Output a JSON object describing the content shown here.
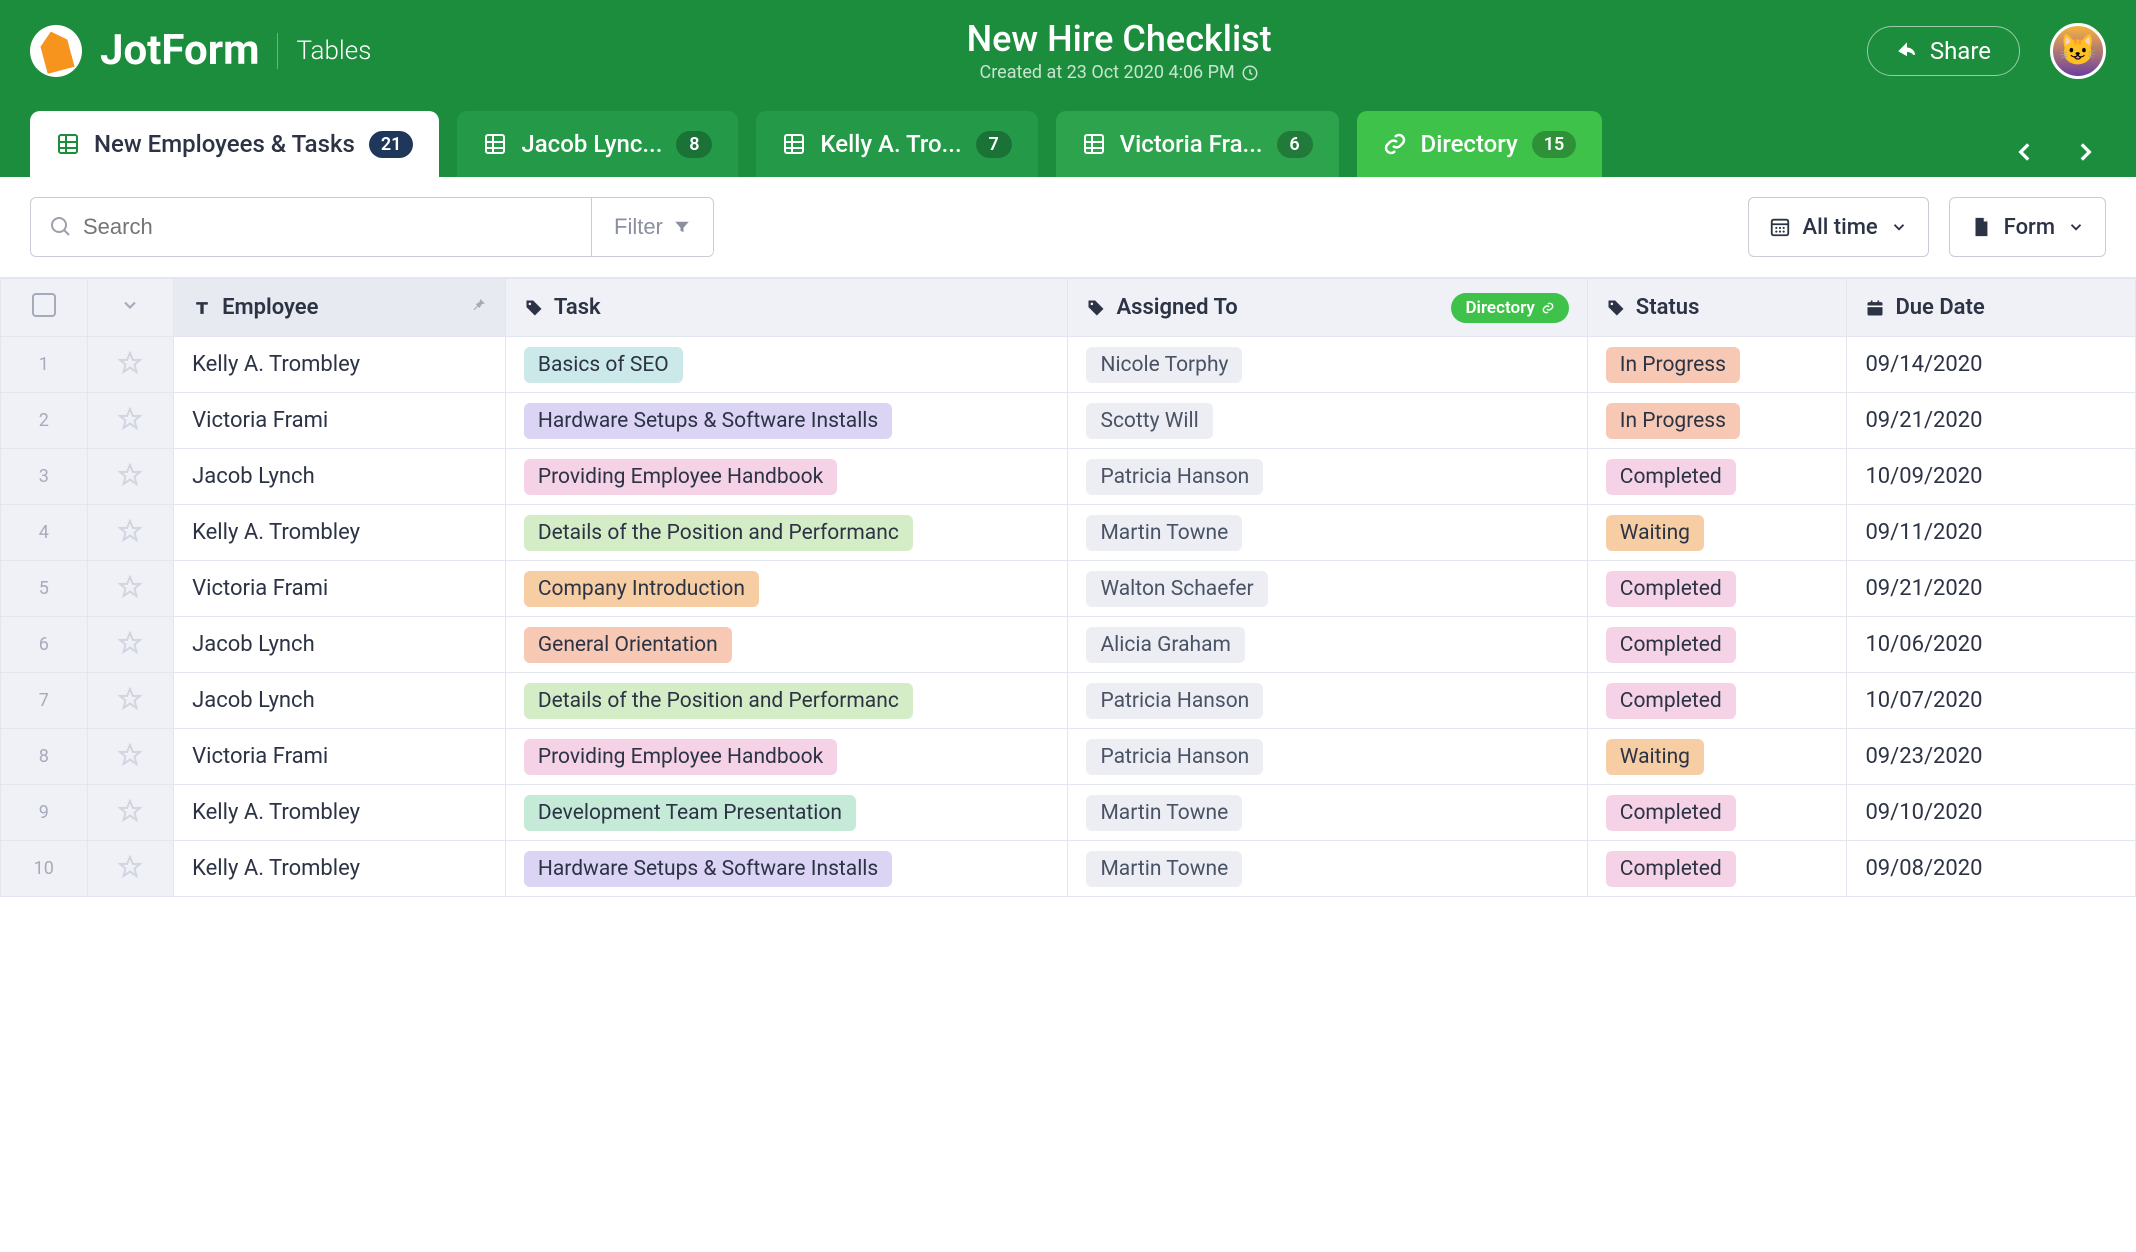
{
  "header": {
    "brand": "JotForm",
    "section": "Tables",
    "title": "New Hire Checklist",
    "subtitle": "Created at 23 Oct 2020 4:06 PM",
    "share": "Share"
  },
  "tabs": [
    {
      "label": "New Employees & Tasks",
      "badge": "21"
    },
    {
      "label": "Jacob Lync...",
      "badge": "8"
    },
    {
      "label": "Kelly A. Tro...",
      "badge": "7"
    },
    {
      "label": "Victoria Fra...",
      "badge": "6"
    },
    {
      "label": "Directory",
      "badge": "15"
    }
  ],
  "toolbar": {
    "search_placeholder": "Search",
    "filter": "Filter",
    "alltime": "All time",
    "form": "Form"
  },
  "columns": {
    "employee": "Employee",
    "task": "Task",
    "assigned": "Assigned To",
    "directory": "Directory",
    "status": "Status",
    "due": "Due Date"
  },
  "rows": [
    {
      "n": "1",
      "employee": "Kelly A. Trombley",
      "task": "Basics of SEO",
      "task_c": "c-seo",
      "assigned": "Nicole Torphy",
      "status": "In Progress",
      "s_c": "s-progress",
      "due": "09/14/2020"
    },
    {
      "n": "2",
      "employee": "Victoria Frami",
      "task": "Hardware Setups & Software Installs",
      "task_c": "c-hw",
      "assigned": "Scotty Will",
      "status": "In Progress",
      "s_c": "s-progress",
      "due": "09/21/2020"
    },
    {
      "n": "3",
      "employee": "Jacob Lynch",
      "task": "Providing Employee Handbook",
      "task_c": "c-handbook",
      "assigned": "Patricia Hanson",
      "status": "Completed",
      "s_c": "s-completed",
      "due": "10/09/2020"
    },
    {
      "n": "4",
      "employee": "Kelly A. Trombley",
      "task": "Details of the Position and Performanc",
      "task_c": "c-details",
      "assigned": "Martin Towne",
      "status": "Waiting",
      "s_c": "s-waiting",
      "due": "09/11/2020"
    },
    {
      "n": "5",
      "employee": "Victoria Frami",
      "task": "Company Introduction",
      "task_c": "c-company",
      "assigned": "Walton Schaefer",
      "status": "Completed",
      "s_c": "s-completed",
      "due": "09/21/2020"
    },
    {
      "n": "6",
      "employee": "Jacob Lynch",
      "task": "General Orientation",
      "task_c": "c-orient",
      "assigned": "Alicia Graham",
      "status": "Completed",
      "s_c": "s-completed",
      "due": "10/06/2020"
    },
    {
      "n": "7",
      "employee": "Jacob Lynch",
      "task": "Details of the Position and Performanc",
      "task_c": "c-details",
      "assigned": "Patricia Hanson",
      "status": "Completed",
      "s_c": "s-completed",
      "due": "10/07/2020"
    },
    {
      "n": "8",
      "employee": "Victoria Frami",
      "task": "Providing Employee Handbook",
      "task_c": "c-handbook",
      "assigned": "Patricia Hanson",
      "status": "Waiting",
      "s_c": "s-waiting",
      "due": "09/23/2020"
    },
    {
      "n": "9",
      "employee": "Kelly A. Trombley",
      "task": "Development Team Presentation",
      "task_c": "c-devteam",
      "assigned": "Martin Towne",
      "status": "Completed",
      "s_c": "s-completed",
      "due": "09/10/2020"
    },
    {
      "n": "10",
      "employee": "Kelly A. Trombley",
      "task": "Hardware Setups & Software Installs",
      "task_c": "c-hw",
      "assigned": "Martin Towne",
      "status": "Completed",
      "s_c": "s-completed",
      "due": "09/08/2020"
    }
  ]
}
